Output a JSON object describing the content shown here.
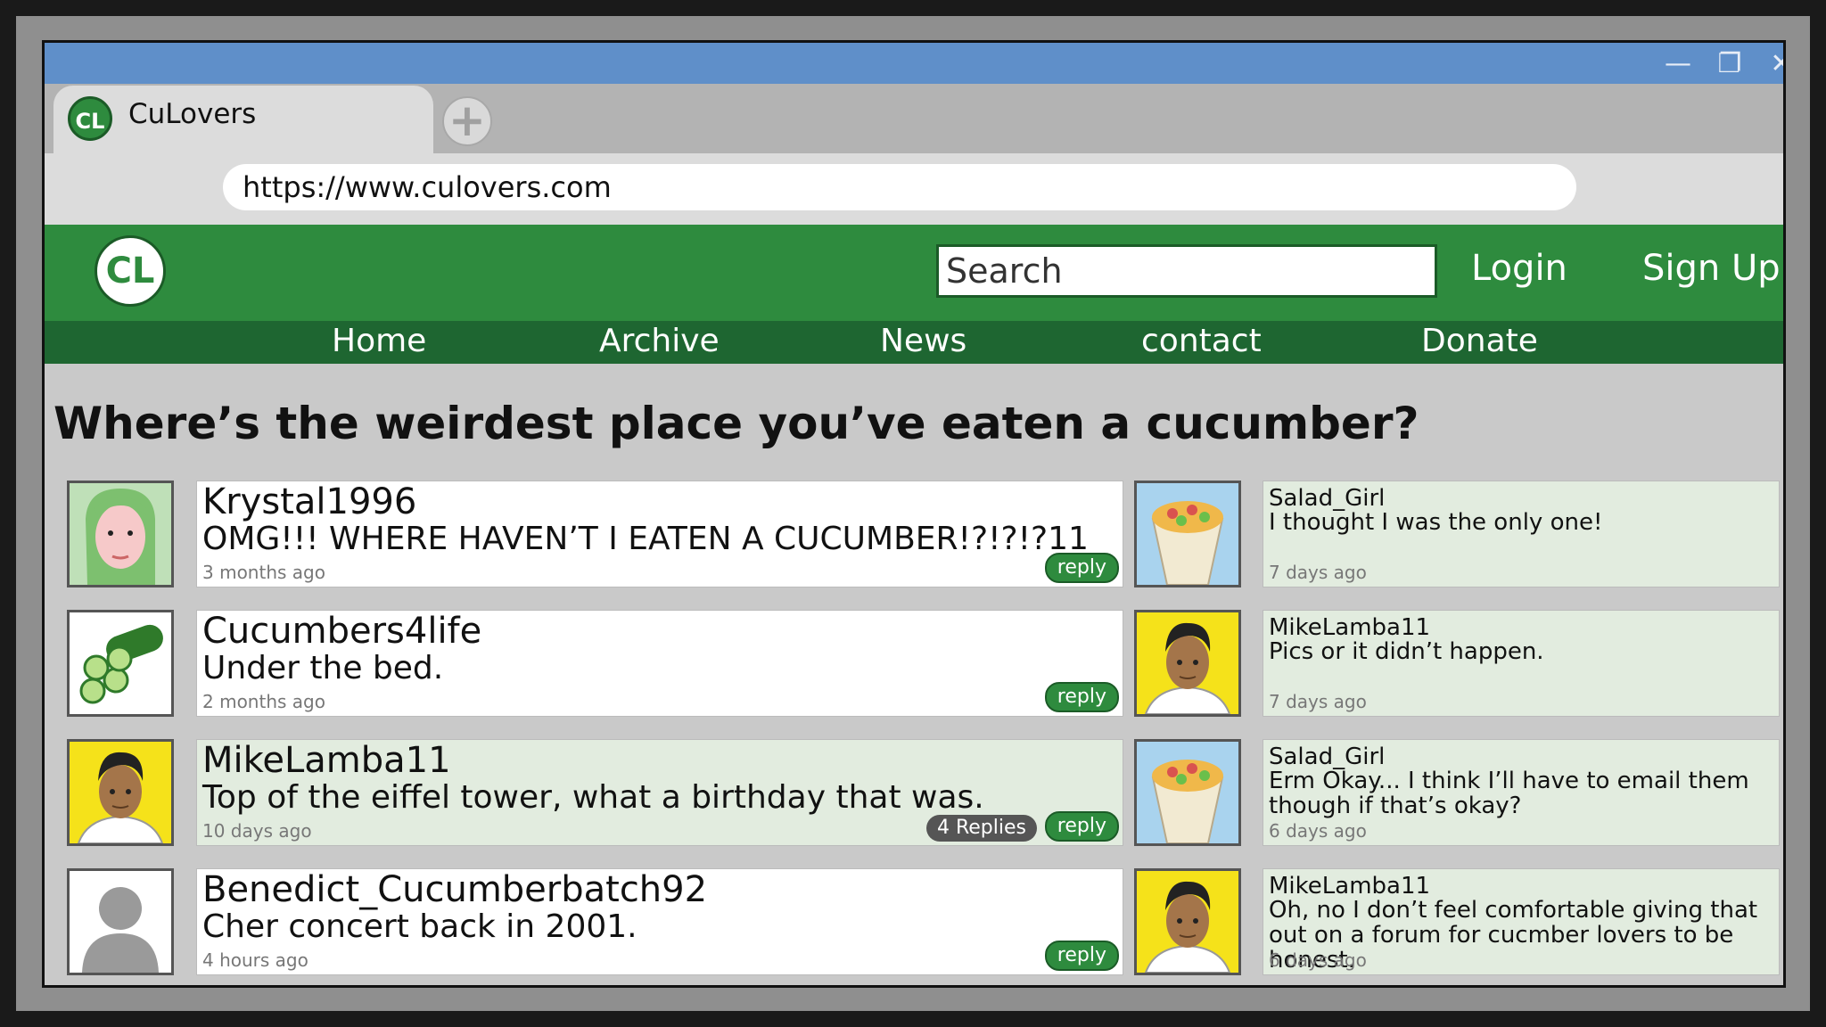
{
  "browser": {
    "tab_title": "CuLovers",
    "tab_logo": "CL",
    "new_tab_icon": "+",
    "url": "https://www.culovers.com",
    "window_controls": {
      "minimize": "—",
      "maximize": "❐",
      "close": "✕"
    }
  },
  "site": {
    "logo": "CL",
    "search_placeholder": "Search",
    "login_label": "Login",
    "signup_label": "Sign Up",
    "nav": [
      "Home",
      "Archive",
      "News",
      "contact",
      "Donate"
    ],
    "colors": {
      "primary": "#2e8b3e",
      "nav": "#1e6631",
      "highlight": "#e2ecdf",
      "background": "#c9c9c9"
    }
  },
  "thread": {
    "question": "Where’s the weirdest place you’ve eaten a cucumber?",
    "comments": [
      {
        "user": "Krystal1996",
        "text": "OMG!!! WHERE HAVEN’T I EATEN A CUCUMBER!?!?!?11",
        "time": "3 months ago",
        "reply_label": "reply",
        "avatar": "green-haired-woman-avatar"
      },
      {
        "user": "Cucumbers4life",
        "text": "Under the bed.",
        "time": "2 months ago",
        "reply_label": "reply",
        "avatar": "sliced-cucumber-avatar"
      },
      {
        "user": "MikeLamba11",
        "text": "Top of the eiffel tower, what a birthday that was.",
        "time": "10 days ago",
        "reply_label": "reply",
        "replies_label": "4 Replies",
        "avatar": "man-portrait-avatar",
        "highlighted": true
      },
      {
        "user": "Benedict_Cucumberbatch92",
        "text": "Cher concert back in 2001.",
        "time": "4 hours ago",
        "reply_label": "reply",
        "avatar": "default-silhouette-avatar"
      }
    ],
    "replies": [
      {
        "user": "Salad_Girl",
        "text": "I thought I was the only one!",
        "time": "7 days ago",
        "avatar": "wrap-avatar"
      },
      {
        "user": "MikeLamba11",
        "text": "Pics or it didn’t happen.",
        "time": "7 days ago",
        "avatar": "man-portrait-avatar"
      },
      {
        "user": "Salad_Girl",
        "text": "Erm Okay... I think I’ll have to email them though if that’s okay?",
        "time": "6 days ago",
        "avatar": "wrap-avatar"
      },
      {
        "user": "MikeLamba11",
        "text": "Oh, no I don’t feel comfortable giving that out on a forum for cucmber lovers to be honest.",
        "time": "6 days ago",
        "avatar": "man-portrait-avatar"
      }
    ]
  }
}
